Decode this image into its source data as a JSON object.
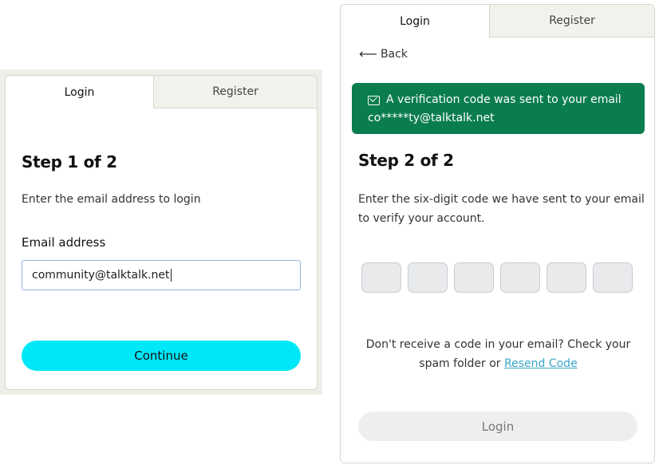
{
  "left_panel": {
    "tabs": {
      "login": "Login",
      "register": "Register"
    },
    "step_title": "Step 1 of 2",
    "instruction": "Enter the email address to login",
    "email_label": "Email address",
    "email_value": "community@talktalk.net",
    "continue_label": "Continue",
    "accent_color": "#00e8f8"
  },
  "right_panel": {
    "tabs": {
      "login": "Login",
      "register": "Register"
    },
    "back_label": "Back",
    "alert": {
      "line1": "A verification code was sent to your email",
      "line2": "co*****ty@talktalk.net",
      "icon": "mail-check-icon",
      "color": "#0a7d4e"
    },
    "step_title": "Step 2 of 2",
    "instruction_line1": "Enter the six-digit code we have sent to your email",
    "instruction_line2": "to verify your account.",
    "code_digits": [
      "",
      "",
      "",
      "",
      "",
      ""
    ],
    "help_line1": "Don't receive a code in your email? Check your",
    "help_line2_prefix": "spam folder or ",
    "resend_label": "Resend Code",
    "login_label": "Login"
  }
}
